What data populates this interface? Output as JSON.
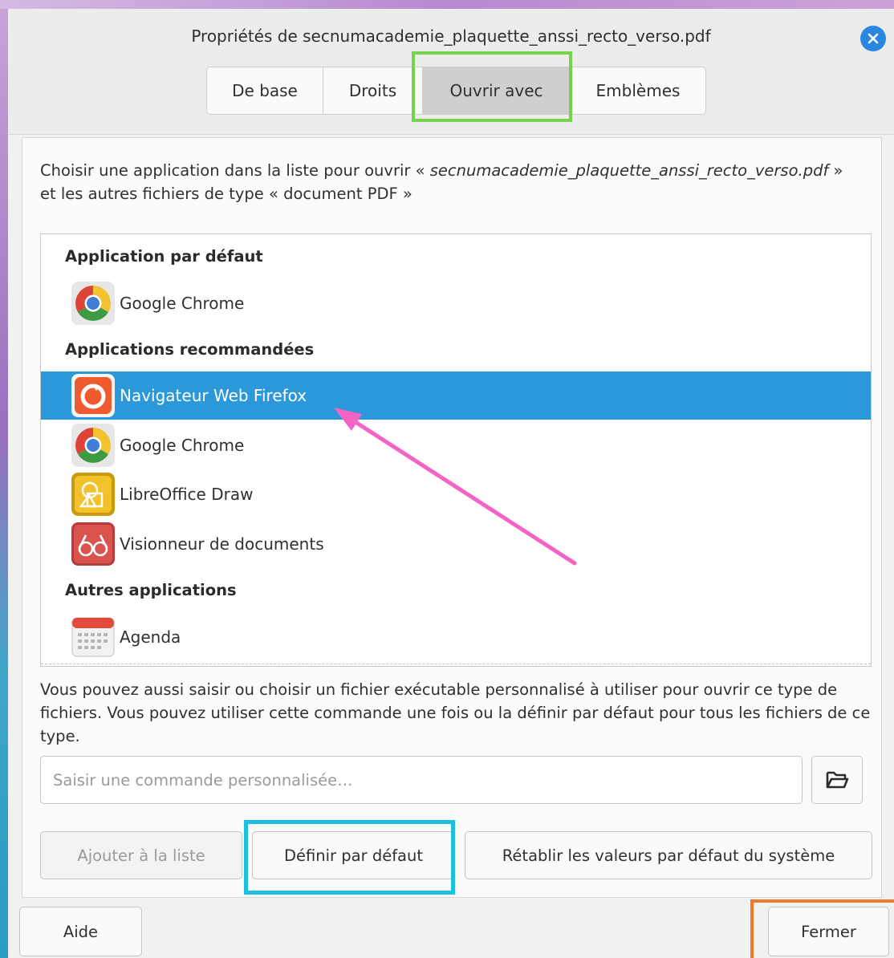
{
  "window": {
    "title": "Propriétés de secnumacademie_plaquette_anssi_recto_verso.pdf"
  },
  "tabs": [
    {
      "label": "De base"
    },
    {
      "label": "Droits"
    },
    {
      "label": "Ouvrir avec",
      "active": true
    },
    {
      "label": "Emblèmes"
    }
  ],
  "intro": {
    "prefix": "Choisir une application dans la liste pour ouvrir « ",
    "filename": "secnumacademie_plaquette_anssi_recto_verso.pdf",
    "suffix": " » et les autres fichiers de type « document PDF »"
  },
  "app_list": {
    "sections": [
      {
        "header": "Application par défaut"
      },
      {
        "header": "Applications recommandées"
      },
      {
        "header": "Autres applications"
      }
    ],
    "apps": [
      {
        "label": "Google Chrome",
        "icon": "chrome-icon",
        "section": "Application par défaut"
      },
      {
        "label": "Navigateur Web Firefox",
        "icon": "firefox-icon",
        "section": "Applications recommandées",
        "selected": true
      },
      {
        "label": "Google Chrome",
        "icon": "chrome-icon",
        "section": "Applications recommandées"
      },
      {
        "label": "LibreOffice Draw",
        "icon": "libreoffice-draw-icon",
        "section": "Applications recommandées"
      },
      {
        "label": "Visionneur de documents",
        "icon": "document-viewer-icon",
        "section": "Applications recommandées"
      },
      {
        "label": "Agenda",
        "icon": "calendar-icon",
        "section": "Autres applications"
      }
    ]
  },
  "custom_command": {
    "description": "Vous pouvez aussi saisir ou choisir un fichier exécutable personnalisé à utiliser pour ouvrir ce type de fichiers. Vous pouvez utiliser cette commande une fois ou la définir par défaut pour tous les fichiers de ce type.",
    "placeholder": "Saisir une commande personnalisée…",
    "value": ""
  },
  "actions": {
    "add_to_list": "Ajouter à la liste",
    "set_default": "Définir par défaut",
    "reset": "Rétablir les valeurs par défaut du système"
  },
  "footer": {
    "help": "Aide",
    "close": "Fermer"
  },
  "colors": {
    "selection": "#2a98d9",
    "highlight_tab": "#73d34a",
    "highlight_default": "#1bbfdf",
    "highlight_close": "#f07b2a",
    "annotation_arrow": "#f464c4",
    "close_button": "#2a86e0"
  }
}
